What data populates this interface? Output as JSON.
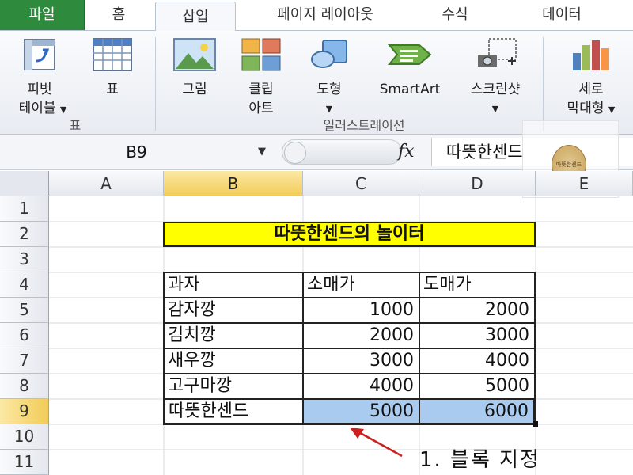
{
  "ribbon": {
    "tabs": [
      "파일",
      "홈",
      "삽입",
      "페이지 레이아웃",
      "수식",
      "데이터"
    ],
    "items": {
      "pivot_line1": "피벗",
      "pivot_line2": "테이블",
      "table": "표",
      "picture": "그림",
      "clipart_line1": "클립",
      "clipart_line2": "아트",
      "shapes": "도형",
      "smartart": "SmartArt",
      "screenshot": "스크린샷",
      "column_line1": "세로",
      "column_line2": "막대형"
    },
    "groups": {
      "tables": "표",
      "illustrations": "일러스트레이션"
    }
  },
  "formula_bar": {
    "name_box": "B9",
    "fx": "fx",
    "value": "따뜻한센드"
  },
  "grid": {
    "columns": [
      "A",
      "B",
      "C",
      "D",
      "E"
    ],
    "rows": [
      "1",
      "2",
      "3",
      "4",
      "5",
      "6",
      "7",
      "8",
      "9",
      "10",
      "11"
    ],
    "selected_column": "B",
    "selected_row": "9"
  },
  "sheet": {
    "title": "따뜻한센드의 놀이터",
    "headers": [
      "과자",
      "소매가",
      "도매가"
    ],
    "rows": [
      [
        "감자깡",
        "1000",
        "2000"
      ],
      [
        "김치깡",
        "2000",
        "3000"
      ],
      [
        "새우깡",
        "3000",
        "4000"
      ],
      [
        "고구마깡",
        "4000",
        "5000"
      ],
      [
        "따뜻한센드",
        "5000",
        "6000"
      ]
    ]
  },
  "annotation": "1. 블록 지정",
  "stamp_text": "따뜻한센드",
  "colors": {
    "file_tab": "#2e8b3e",
    "title_fill": "#ffff00",
    "selection": "#a9cbef",
    "arrow": "#cc1f1f"
  }
}
